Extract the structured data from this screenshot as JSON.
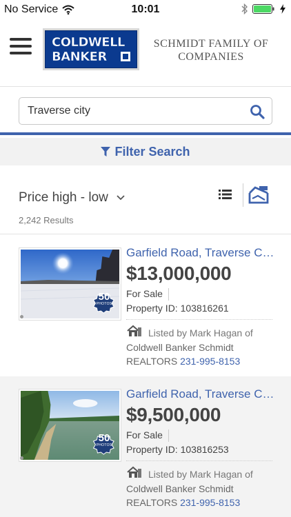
{
  "status_bar": {
    "carrier": "No Service",
    "time": "10:01"
  },
  "header": {
    "logo_line1": "COLDWELL",
    "logo_line2": "BANKER",
    "company_line1": "SCHMIDT FAMILY OF",
    "company_line2": "COMPANIES"
  },
  "search": {
    "value": "Traverse city"
  },
  "filter": {
    "label": "Filter Search"
  },
  "sort": {
    "selected": "Price high - low",
    "results": "2,242 Results"
  },
  "listings": [
    {
      "address": "Garfield Road, Traverse City, MI",
      "price": "$13,000,000",
      "status": "For Sale",
      "property_id": "Property ID: 103816261",
      "photo_badge_count": "50",
      "photo_badge_label": "PHOTOS",
      "listed_by": "Listed by Mark Hagan of",
      "company": "Coldwell Banker Schmidt",
      "realtors": "REALTORS",
      "phone": "231-995-8153"
    },
    {
      "address": "Garfield Road, Traverse City, MI",
      "price": "$9,500,000",
      "status": "For Sale",
      "property_id": "Property ID: 103816253",
      "photo_badge_count": "50",
      "photo_badge_label": "PHOTOS",
      "listed_by": "Listed by Mark Hagan of",
      "company": "Coldwell Banker Schmidt",
      "realtors": "REALTORS",
      "phone": "231-995-8153"
    }
  ],
  "colors": {
    "accent": "#3f63ad",
    "brand_blue": "#0b3a8f",
    "battery": "#4cd964"
  }
}
